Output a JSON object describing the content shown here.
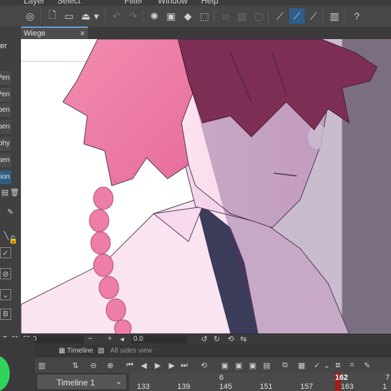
{
  "menubar": {
    "items": [
      "Layer",
      "Select",
      "Filter",
      "Window",
      "Help"
    ]
  },
  "toolbar": {
    "icons": [
      "app-icon",
      "new-file-icon",
      "open-folder-icon",
      "save-icon",
      "undo-icon",
      "redo-icon",
      "loading-icon",
      "clear-icon",
      "fill-icon",
      "transform-icon",
      "crop-icon",
      "hide-selection-icon",
      "snap-ruler-icon",
      "snap-special-ruler-icon",
      "snap-grid-icon",
      "pen-stroke-icon",
      "smoothing-icon",
      "companion-icon",
      "help-icon"
    ]
  },
  "layers_panel": {
    "header": "er",
    "rows": [
      "Pen",
      "Pen",
      "pen",
      "pen",
      "phy",
      "pen",
      "ion"
    ],
    "selected_index": 6
  },
  "document_tab": {
    "title": "Wiege",
    "close": "×"
  },
  "statusbar": {
    "zoom": "55.0",
    "minus": "−",
    "plus": "+",
    "angle": "0.0"
  },
  "timeline_tabs": {
    "timeline": "Timeline",
    "all_sides": "All sides view"
  },
  "timeline": {
    "name": "Timeline 1",
    "ruler_top": [
      {
        "text": "6",
        "pos": 0
      },
      {
        "text": "162",
        "pos": 1
      },
      {
        "text": "7",
        "pos": 2
      }
    ],
    "ruler_bottom": [
      "133",
      "139",
      "145",
      "151",
      "157",
      "163",
      "1"
    ],
    "current_frame": "162"
  },
  "colors": {
    "accent": "#2f5d85",
    "playhead": "#a41c1c",
    "hair_pink": "#e8749f",
    "hair_dark": "#7a2640"
  }
}
